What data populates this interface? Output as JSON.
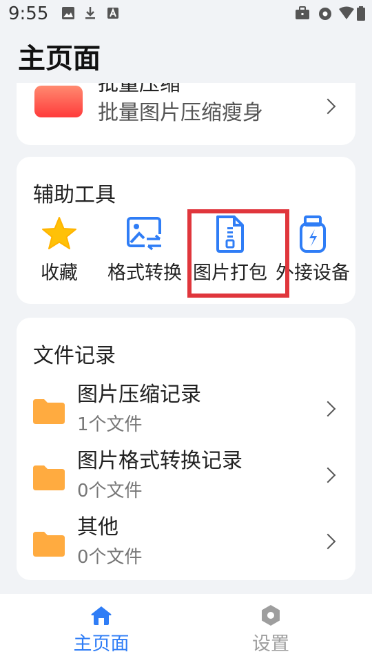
{
  "status_bar": {
    "time": "9:55"
  },
  "page": {
    "title": "主页面"
  },
  "batch_card": {
    "title": "批量压缩",
    "subtitle": "批量图片压缩瘦身"
  },
  "tools": {
    "heading": "辅助工具",
    "items": [
      {
        "label": "收藏",
        "icon": "star-icon"
      },
      {
        "label": "格式转换",
        "icon": "image-convert-icon"
      },
      {
        "label": "图片打包",
        "icon": "zip-file-icon"
      },
      {
        "label": "外接设备",
        "icon": "usb-drive-icon"
      }
    ]
  },
  "records": {
    "heading": "文件记录",
    "items": [
      {
        "name": "图片压缩记录",
        "count": "1个文件"
      },
      {
        "name": "图片格式转换记录",
        "count": "0个文件"
      },
      {
        "name": "其他",
        "count": "0个文件"
      }
    ]
  },
  "nav": {
    "home": "主页面",
    "settings": "设置"
  },
  "colors": {
    "accent": "#2f7df6",
    "highlight": "#e0363c",
    "folder": "#ffab40",
    "star": "#ffc107",
    "inactive": "#9e9e9e"
  }
}
